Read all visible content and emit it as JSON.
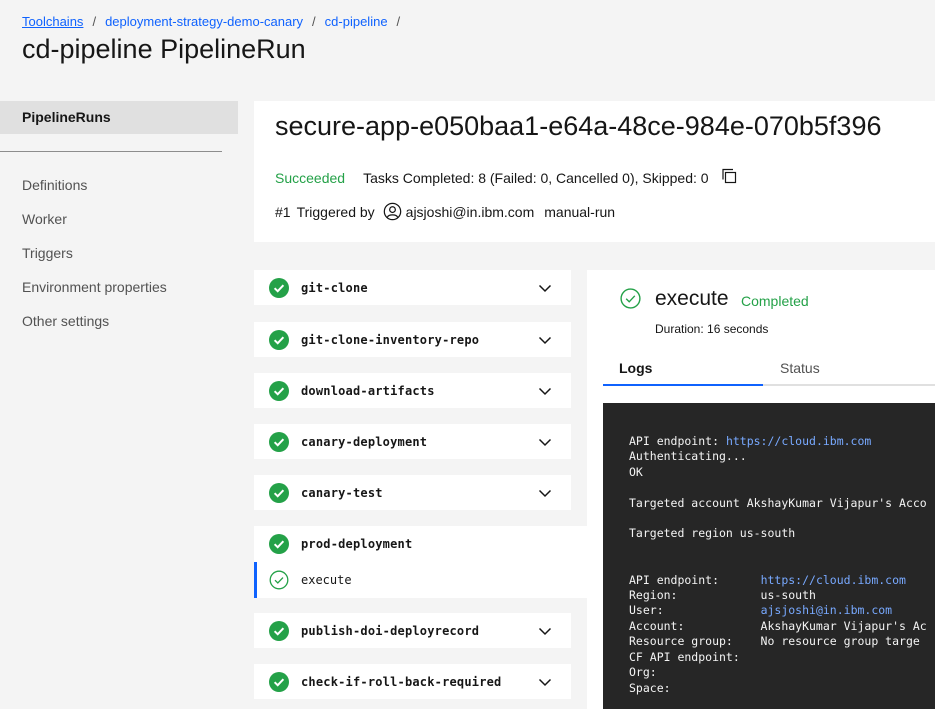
{
  "breadcrumb": {
    "items": [
      "Toolchains",
      "deployment-strategy-demo-canary",
      "cd-pipeline"
    ],
    "separator": "/"
  },
  "page_title": "cd-pipeline PipelineRun",
  "sidebar": {
    "active": "PipelineRuns",
    "items": [
      "Definitions",
      "Worker",
      "Triggers",
      "Environment properties",
      "Other settings"
    ]
  },
  "run": {
    "id": "secure-app-e050baa1-e64a-48ce-984e-070b5f396",
    "status": "Succeeded",
    "tasks_summary": "Tasks Completed: 8 (Failed: 0, Cancelled 0), Skipped: 0",
    "number": "#1",
    "triggered_by_label": "Triggered by",
    "user": "ajsjoshi@in.ibm.com",
    "trigger": "manual-run"
  },
  "tasks": [
    "git-clone",
    "git-clone-inventory-repo",
    "download-artifacts",
    "canary-deployment",
    "canary-test",
    "prod-deployment",
    "publish-doi-deployrecord",
    "check-if-roll-back-required"
  ],
  "selected_step": "execute",
  "detail": {
    "title": "execute",
    "status": "Completed",
    "duration": "Duration: 16 seconds",
    "tabs": [
      "Logs",
      "Status"
    ]
  },
  "logs": {
    "api_endpoint_label": "API endpoint: ",
    "api_url": "https://cloud.ibm.com",
    "authenticating": "Authenticating...",
    "ok": "OK",
    "targeted_account": "Targeted account AkshayKumar Vijapur's Acco",
    "targeted_region": "Targeted region us-south",
    "api_endpoint_label2": "API endpoint:      ",
    "api_url2": "https://cloud.ibm.com",
    "region_line": "Region:            us-south",
    "user_label": "User:              ",
    "user_value": "ajsjoshi@in.ibm.com",
    "account_line": "Account:           AkshayKumar Vijapur's Ac",
    "resource_group_line": "Resource group:    No resource group targe",
    "cf_api_line": "CF API endpoint:",
    "org_line": "Org:",
    "space_line": "Space:"
  },
  "colors": {
    "success": "#24a148",
    "accent": "#0f62fe",
    "link_in_logs": "#78a9ff",
    "log_bg": "#262626"
  }
}
